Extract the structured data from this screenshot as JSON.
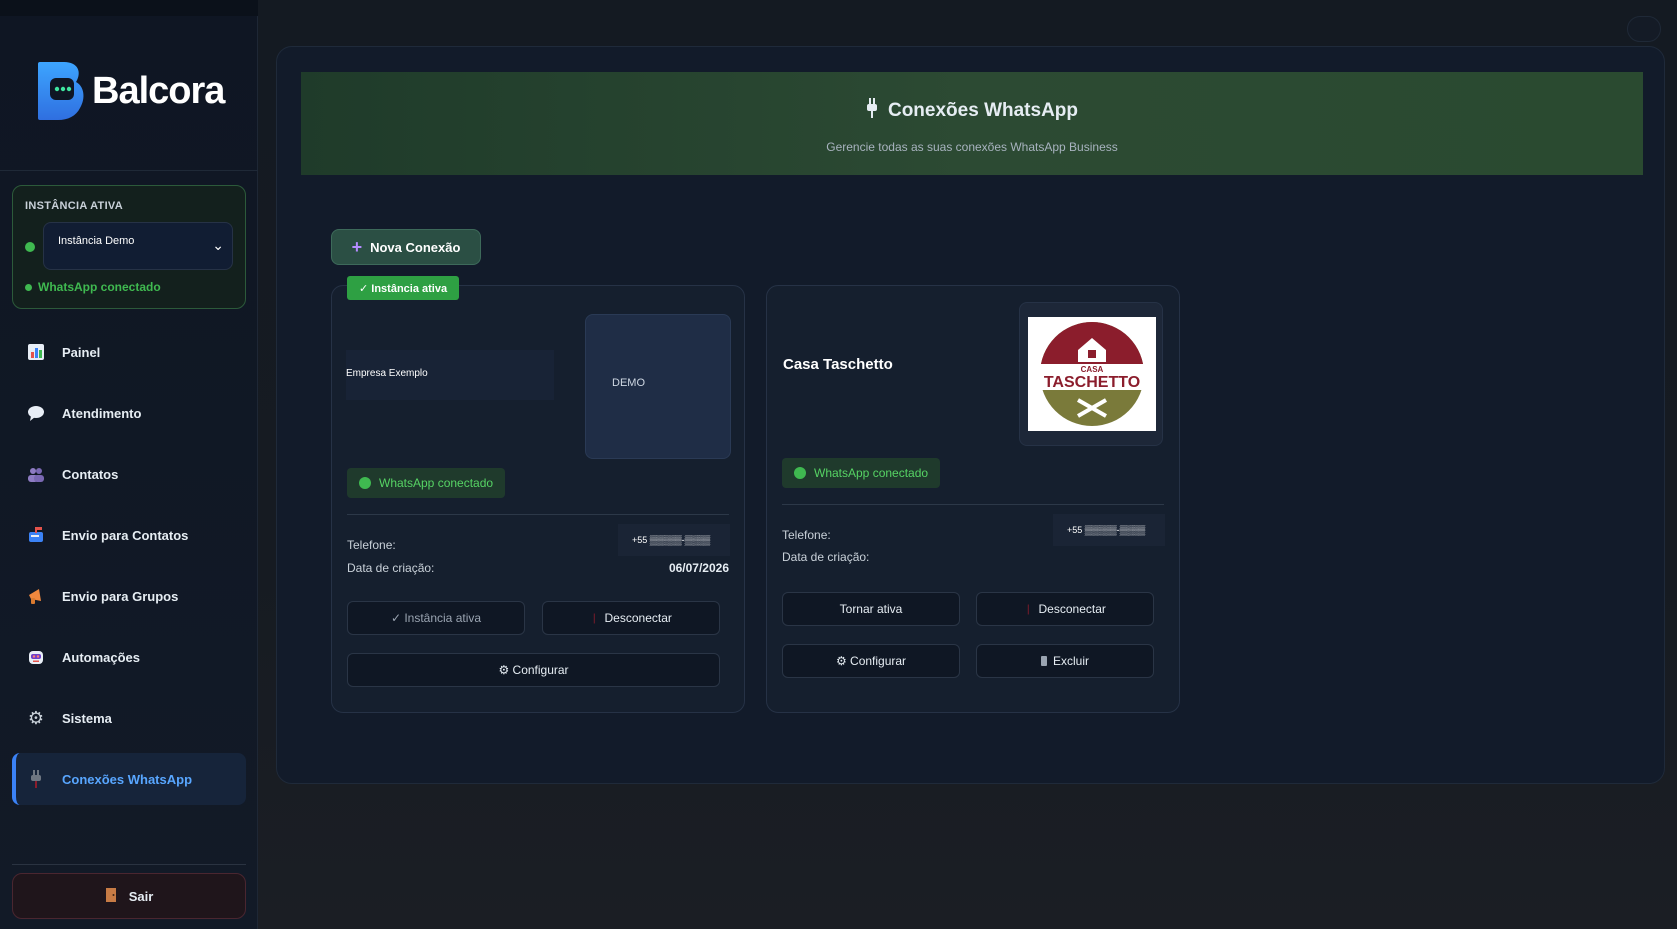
{
  "sidebar": {
    "brand": "Balcora",
    "instance": {
      "title": "INSTÂNCIA ATIVA",
      "selected": "Instância Demo",
      "status": "WhatsApp conectado"
    },
    "nav": [
      {
        "label": "Painel",
        "icon": "chart-icon"
      },
      {
        "label": "Atendimento",
        "icon": "chat-bubble-icon"
      },
      {
        "label": "Contatos",
        "icon": "users-icon"
      },
      {
        "label": "Envio para Contatos",
        "icon": "mailbox-icon"
      },
      {
        "label": "Envio para Grupos",
        "icon": "megaphone-icon"
      },
      {
        "label": "Automações",
        "icon": "robot-icon"
      },
      {
        "label": "Sistema",
        "icon": "gear-icon"
      },
      {
        "label": "Conexões WhatsApp",
        "icon": "plug-icon",
        "active": true
      }
    ],
    "logout": "Sair"
  },
  "header": {
    "title": "Conexões WhatsApp",
    "subtitle": "Gerencie todas as suas conexões WhatsApp Business"
  },
  "new_button": "Nova Conexão",
  "cards": [
    {
      "badge": "✓ Instância ativa",
      "name": "Empresa Exemplo",
      "image_text": "DEMO",
      "status": "WhatsApp conectado",
      "phone_label": "Telefone:",
      "phone": "+55 ▒▒▒▒▒-▒▒▒▒",
      "created_label": "Data de criação:",
      "created": "06/07/2026",
      "buttons": [
        "✓ Instância ativa",
        "Desconectar",
        "⚙ Configurar"
      ]
    },
    {
      "name": "Casa Taschetto",
      "logo_text": [
        "CASA",
        "TASCHETTO"
      ],
      "status": "WhatsApp conectado",
      "phone_label": "Telefone:",
      "phone": "+55 ▒▒▒▒▒-▒▒▒▒",
      "created_label": "Data de criação:",
      "buttons": [
        "Tornar ativa",
        "Desconectar",
        "⚙ Configurar",
        "Excluir"
      ]
    }
  ],
  "colors": {
    "accent_green": "#3fb950",
    "active_blue": "#3b82f6",
    "header_green": "#2c4a33"
  }
}
